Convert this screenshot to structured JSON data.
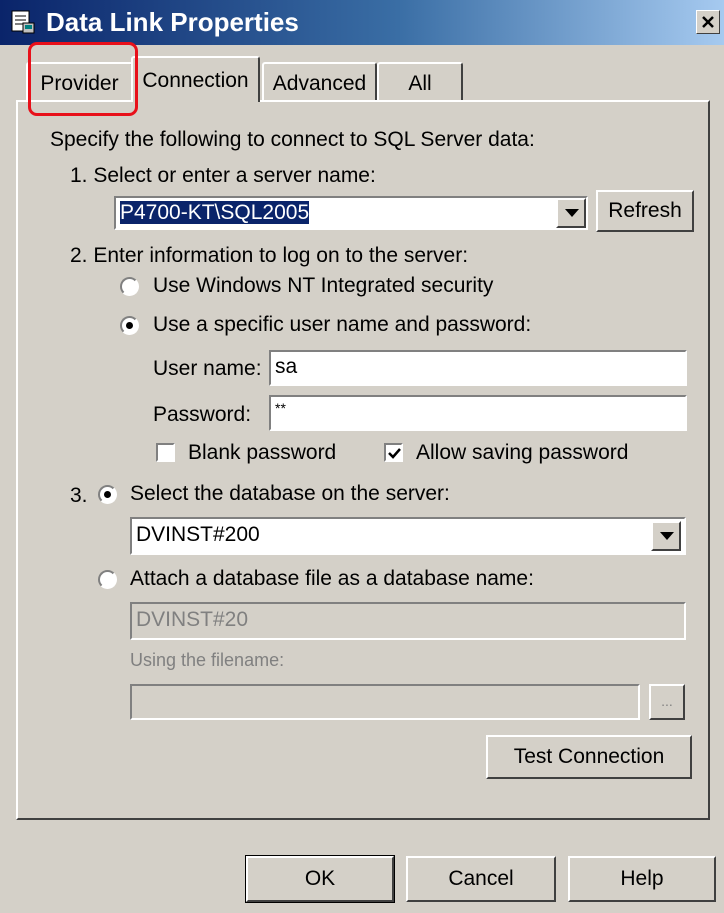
{
  "window": {
    "title": "Data Link Properties",
    "icon": "data-link-icon",
    "close_icon": "close-icon"
  },
  "tabs": [
    {
      "label": "Provider",
      "active": false
    },
    {
      "label": "Connection",
      "active": true
    },
    {
      "label": "Advanced",
      "active": false
    },
    {
      "label": "All",
      "active": false
    }
  ],
  "annotation": {
    "highlight_color": "#e8101a",
    "highlighted_tab": "Provider"
  },
  "connection": {
    "intro": "Specify the following to connect to SQL Server data:",
    "step1": {
      "number": "1.",
      "label_before": "Select or enter a server name:",
      "server_value": "P4700-KT\\SQL2005",
      "refresh_button": "Refresh"
    },
    "step2": {
      "label": "2. Enter information to log on to the server:",
      "radio_nt": "Use Windows NT Integrated security",
      "radio_specific": "Use a specific user name and password:",
      "selected": "specific",
      "user_label": "User name:",
      "user_value": "sa",
      "password_label": "Password:",
      "password_value": "**",
      "blank_password": {
        "label": "Blank password",
        "checked": false
      },
      "allow_saving": {
        "label": "Allow saving password",
        "checked": true
      }
    },
    "step3": {
      "number": "3.",
      "radio_select_db": "Select the database on the server:",
      "db_value": "DVINST#200",
      "radio_attach": "Attach a database file as a database name:",
      "attach_value": "DVINST#20",
      "filename_label": "Using the filename:",
      "filename_value": "",
      "browse_button": "...",
      "selected": "select_db"
    },
    "test_button": "Test Connection"
  },
  "footer": {
    "ok": "OK",
    "cancel": "Cancel",
    "help": "Help"
  },
  "colors": {
    "face": "#d4d0c8",
    "title_start": "#0a246a",
    "title_end": "#a6caf0",
    "selection": "#0a246a"
  }
}
